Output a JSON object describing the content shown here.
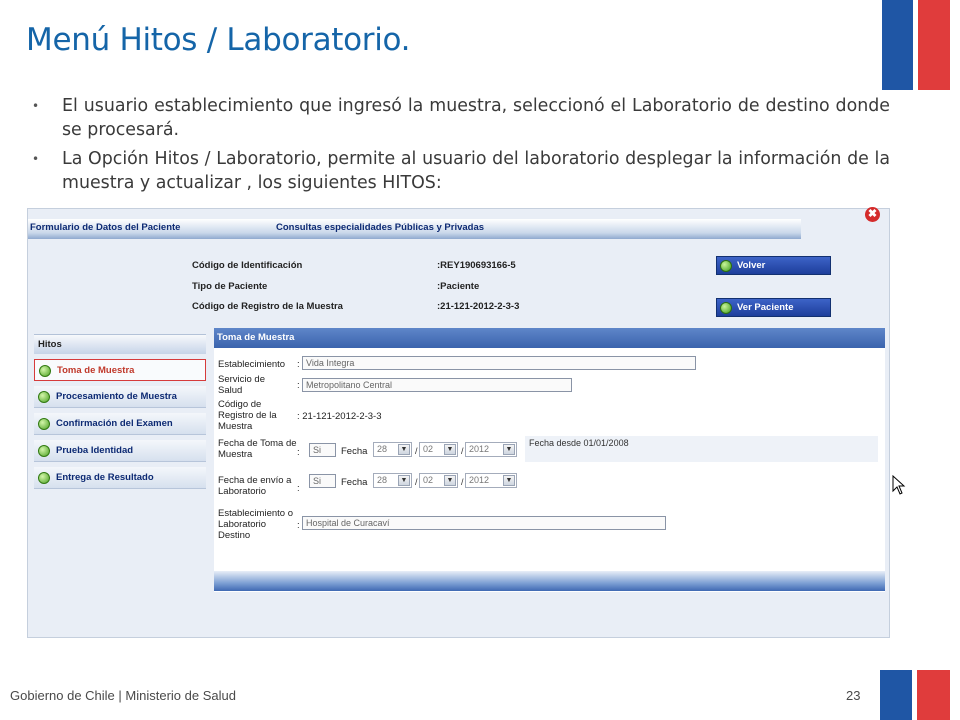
{
  "slide": {
    "title": "Menú Hitos / Laboratorio.",
    "bullets": [
      "El usuario establecimiento que ingresó la muestra, seleccionó el Laboratorio de destino donde se procesará.",
      "La Opción Hitos / Laboratorio, permite al usuario del laboratorio desplegar la información de la muestra y actualizar , los siguientes HITOS:"
    ],
    "footer": "Gobierno de Chile | Ministerio de Salud",
    "page_number": "23",
    "flag_colors": {
      "blue": "#1f56a5",
      "red": "#e03c3c"
    }
  },
  "app": {
    "tabs": [
      "Formulario de Datos del Paciente",
      "Consultas especialidades Públicas y Privadas"
    ],
    "close_icon": "✖",
    "info": [
      {
        "label": "Código de Identificación",
        "value": ":REY190693166-5"
      },
      {
        "label": "Tipo de Paciente",
        "value": ":Paciente"
      },
      {
        "label": "Código de Registro de la Muestra",
        "value": ":21-121-2012-2-3-3"
      }
    ],
    "buttons": {
      "back": "Volver",
      "view_patient": "Ver Paciente"
    },
    "hitos": {
      "header": "Hitos",
      "items": [
        "Toma de Muestra",
        "Procesamiento de Muestra",
        "Confirmación del Examen",
        "Prueba Identidad",
        "Entrega de Resultado"
      ],
      "active": "Toma de Muestra"
    },
    "form": {
      "header": "Toma de Muestra",
      "establecimiento_label": "Establecimiento",
      "establecimiento_value": "Vida Integra",
      "servicio_label": "Servicio de Salud",
      "servicio_value": "Metropolitano Central",
      "codigo_label": "Código de Registro de la Muestra",
      "codigo_value": ": 21-121-2012-2-3-3",
      "fecha_toma_label": "Fecha de Toma de Muestra",
      "fecha_envio_label": "Fecha de envío a Laboratorio",
      "si": "Si",
      "fecha_word": "Fecha",
      "day": "28",
      "month": "02",
      "year": "2012",
      "note": "Fecha desde 01/01/2008",
      "destino_label": "Establecimiento o Laboratorio Destino",
      "destino_value": "Hospital de Curacaví",
      "colon": ":",
      "slash": "/"
    }
  }
}
